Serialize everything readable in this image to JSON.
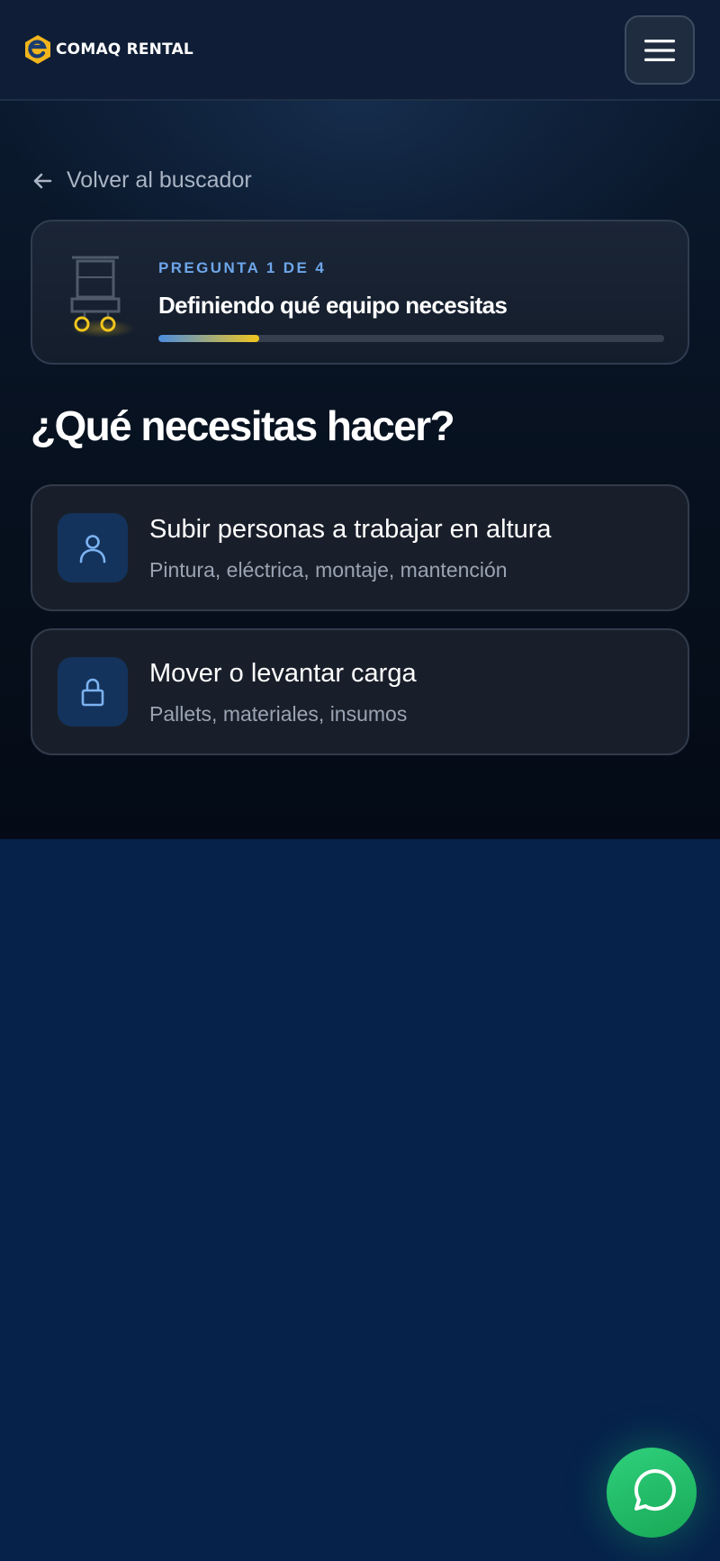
{
  "header": {
    "logo_text": "COMAQ RENTAL",
    "menu_icon": "hamburger-menu-icon"
  },
  "back_link": {
    "label": "Volver al buscador",
    "icon": "arrow-left-icon"
  },
  "progress": {
    "step_label": "PREGUNTA 1 DE 4",
    "title": "Definiendo qué equipo necesitas",
    "fraction": 0.2,
    "gradient_from": "#4b8de0",
    "gradient_to": "#f2c61c"
  },
  "question": {
    "title": "¿Qué necesitas hacer?"
  },
  "options": [
    {
      "title": "Subir personas a trabajar en altura",
      "subtitle": "Pintura, eléctrica, montaje, mantención",
      "icon": "person-icon"
    },
    {
      "title": "Mover o levantar carga",
      "subtitle": "Pallets, materiales, insumos",
      "icon": "lock-icon"
    }
  ],
  "colors": {
    "accent_blue": "#6ea6ea",
    "brand_yellow": "#f2c61c",
    "whatsapp_green": "#22c06a"
  },
  "fab": {
    "icon": "whatsapp-icon"
  }
}
